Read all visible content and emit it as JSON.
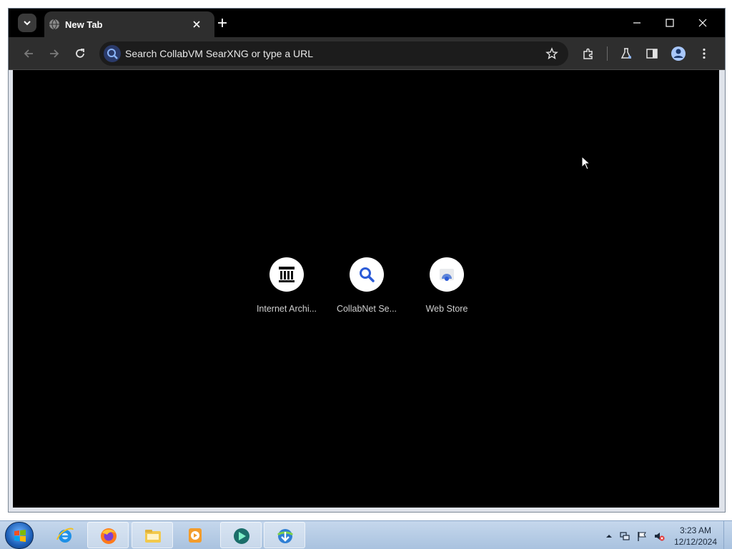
{
  "browser": {
    "tab_title": "New Tab",
    "omnibox_placeholder": "Search CollabVM SearXNG or type a URL"
  },
  "shortcuts": [
    {
      "label": "Internet Archi...",
      "icon": "archive-building-icon"
    },
    {
      "label": "CollabNet Se...",
      "icon": "magnifier-icon"
    },
    {
      "label": "Web Store",
      "icon": "web-store-icon"
    }
  ],
  "taskbar": {
    "apps": [
      "internet-explorer-icon",
      "firefox-icon",
      "file-explorer-icon",
      "media-player-icon",
      "app-icon",
      "download-manager-icon"
    ]
  },
  "clock": {
    "time": "3:23 AM",
    "date": "12/12/2024"
  },
  "colors": {
    "content_bg": "#000000",
    "toolbar_bg": "#2e2e2e",
    "accent": "#8ab4f8"
  }
}
